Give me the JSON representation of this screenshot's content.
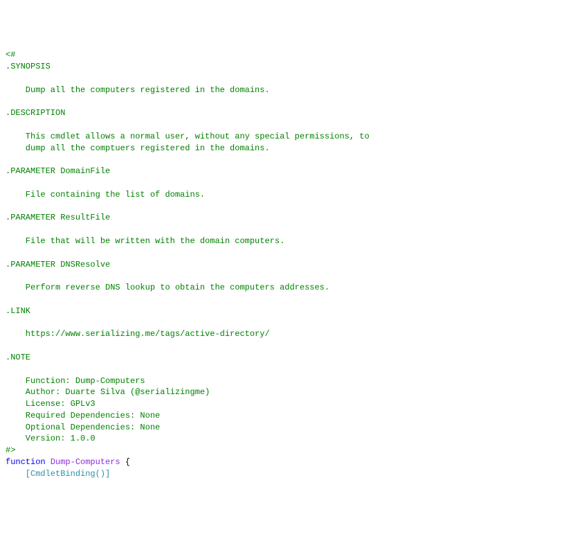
{
  "code": {
    "open": "<#",
    "syn_hdr": ".SYNOPSIS",
    "syn_txt": "    Dump all the computers registered in the domains.",
    "desc_hdr": ".DESCRIPTION",
    "desc_txt1": "    This cmdlet allows a normal user, without any special permissions, to",
    "desc_txt2": "    dump all the comptuers registered in the domains.",
    "p1_hdr": ".PARAMETER DomainFile",
    "p1_txt": "    File containing the list of domains.",
    "p2_hdr": ".PARAMETER ResultFile",
    "p2_txt": "    File that will be written with the domain computers.",
    "p3_hdr": ".PARAMETER DNSResolve",
    "p3_txt": "    Perform reverse DNS lookup to obtain the computers addresses.",
    "link_hdr": ".LINK",
    "link_txt": "    https://www.serializing.me/tags/active-directory/",
    "note_hdr": ".NOTE",
    "note_l1": "    Function: Dump-Computers",
    "note_l2": "    Author: Duarte Silva (@serializingme)",
    "note_l3": "    License: GPLv3",
    "note_l4": "    Required Dependencies: None",
    "note_l5": "    Optional Dependencies: None",
    "note_l6": "    Version: 1.0.0",
    "close": "#>",
    "kw_function": "function",
    "funcname": "Dump-Computers",
    "brace": " {",
    "attr_line": "    [CmdletBinding()]"
  }
}
